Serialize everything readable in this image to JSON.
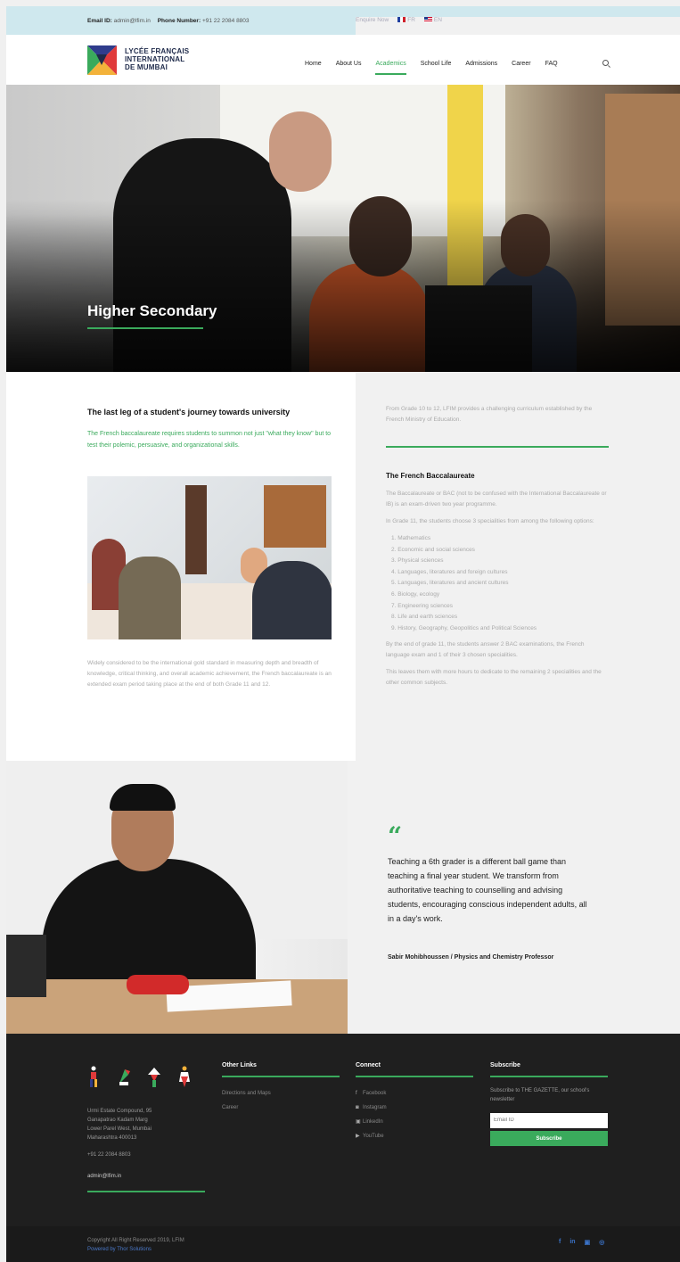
{
  "topbar": {
    "email_label": "Email ID:",
    "email_value": "admin@lfim.in",
    "phone_label": "Phone Number:",
    "phone_value": "+91 22 2084 8803",
    "enquire": "Enquire Now",
    "lang_fr": "FR",
    "lang_en": "EN"
  },
  "header": {
    "logo_line1": "LYCÉE FRANÇAIS",
    "logo_line2": "INTERNATIONAL",
    "logo_line3": "DE MUMBAI",
    "nav": [
      "Home",
      "About Us",
      "Academics",
      "School Life",
      "Admissions",
      "Career",
      "FAQ"
    ],
    "active_nav": "Academics",
    "accent": "#3aaa5c"
  },
  "hero": {
    "title": "Higher Secondary"
  },
  "left": {
    "heading": "The last leg of a student's journey towards university",
    "lead": "The French baccalaureate requires students to summon not just \"what they know\" but to test their polemic, persuasive, and organizational skills.",
    "para": "Widely considered to be the international gold standard in measuring depth and breadth of knowledge, critical thinking, and overall academic achievement, the French baccalaureate is an extended exam period taking place at the end of both Grade 11 and 12."
  },
  "right": {
    "intro": "From Grade 10 to 12, LFIM provides a challenging curriculum established by the French Ministry of Education.",
    "heading": "The French Baccalaureate",
    "p1": "The Baccalaureate or BAC (not to be confused with the International Baccalaureate or IB) is an exam-driven two year programme.",
    "p2": "In Grade 11, the students choose 3 specialities from among the following options:",
    "options": [
      "1. Mathematics",
      "2. Economic and social sciences",
      "3. Physical sciences",
      "4. Languages, literatures and foreign cultures",
      "5. Languages, literatures and ancient cultures",
      "6. Biology, ecology",
      "7. Engineering sciences",
      "8. Life and earth sciences",
      "9. History, Geography, Geopolitics and Political Sciences"
    ],
    "p3": "By the end of grade 11, the students answer 2 BAC examinations, the French language exam and 1 of their 3 chosen specialities.",
    "p4": "This leaves them with more hours to dedicate to the remaining 2 specialities and the other common subjects."
  },
  "testimonial": {
    "mark": "“",
    "quote": "Teaching a 6th grader is a different ball game than teaching a final year student. We transform from authoritative teaching to counselling and advising students, encouraging conscious independent adults, all in a day's work.",
    "author": "Sabir Mohibhoussen  /  Physics and Chemistry Professor"
  },
  "footer": {
    "address_lines": [
      "Urmi Estate Compound, 95",
      "Ganapatrao Kadam Marg",
      "Lower Parel West, Mumbai",
      "Maharashtra 400013"
    ],
    "phone": "+91 22 2084 8803",
    "email": "admin@lfim.in",
    "other_links_title": "Other Links",
    "other_links": [
      "Directions and Maps",
      "Career"
    ],
    "connect_title": "Connect",
    "connect_links": [
      {
        "icon": "facebook-icon",
        "label": "Facebook"
      },
      {
        "icon": "instagram-icon",
        "label": "Instagram"
      },
      {
        "icon": "linkedin-icon",
        "label": "LinkedIn"
      },
      {
        "icon": "youtube-icon",
        "label": "YouTube"
      }
    ],
    "subscribe_title": "Subscribe",
    "subscribe_text": "Subscribe to THE GAZETTE, our school's newsletter",
    "email_placeholder": "Email ID",
    "subscribe_button": "Subscribe",
    "copyright": "Copyright All Right Reserved 2019, LFIM",
    "powered": "Powered by Thor Solutions"
  }
}
